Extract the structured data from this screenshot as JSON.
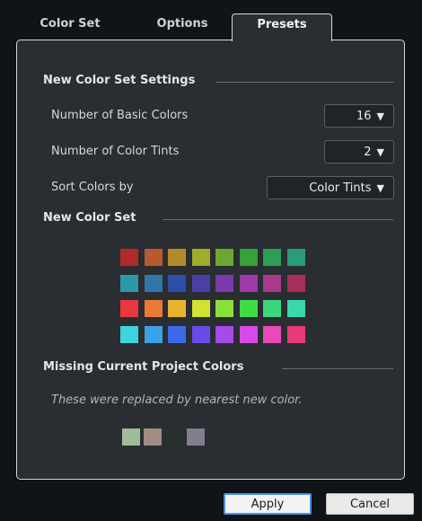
{
  "tabs": [
    {
      "label": "Color Set"
    },
    {
      "label": "Options"
    },
    {
      "label": "Presets"
    }
  ],
  "settings": {
    "title": "New Color Set Settings",
    "rows": [
      {
        "label": "Number of Basic Colors",
        "value": "16"
      },
      {
        "label": "Number of Color Tints",
        "value": "2"
      },
      {
        "label": "Sort Colors by",
        "value": "Color Tints"
      }
    ],
    "caret": "▼"
  },
  "new_color_set": {
    "title": "New Color Set",
    "rows": [
      [
        "#b02a2e",
        "#b85a2e",
        "#b68a2a",
        "#a0ac2a",
        "#6aa832",
        "#36a23a",
        "#2aa054",
        "#2a9c7c"
      ],
      [
        "#2a9aa6",
        "#2e78a8",
        "#2e4ea8",
        "#4a3ea8",
        "#7a3aac",
        "#a03aaa",
        "#a83a8c",
        "#a82e5c"
      ],
      [
        "#e8383c",
        "#ea7a36",
        "#e8b430",
        "#d2e232",
        "#8ae03a",
        "#40dc46",
        "#3ad87a",
        "#3ad6ae"
      ],
      [
        "#3ad6dc",
        "#3aa2e8",
        "#3a6ae8",
        "#6a4ae8",
        "#a64ae8",
        "#d84ae8",
        "#e84ab8",
        "#e83a7a"
      ]
    ]
  },
  "missing": {
    "title": "Missing Current Project Colors",
    "note": "These were replaced by nearest new color.",
    "colors": [
      "#9fbc9a",
      "#9f8c84",
      "#283030",
      "#847c90"
    ]
  },
  "buttons": {
    "apply": "Apply",
    "cancel": "Cancel"
  }
}
